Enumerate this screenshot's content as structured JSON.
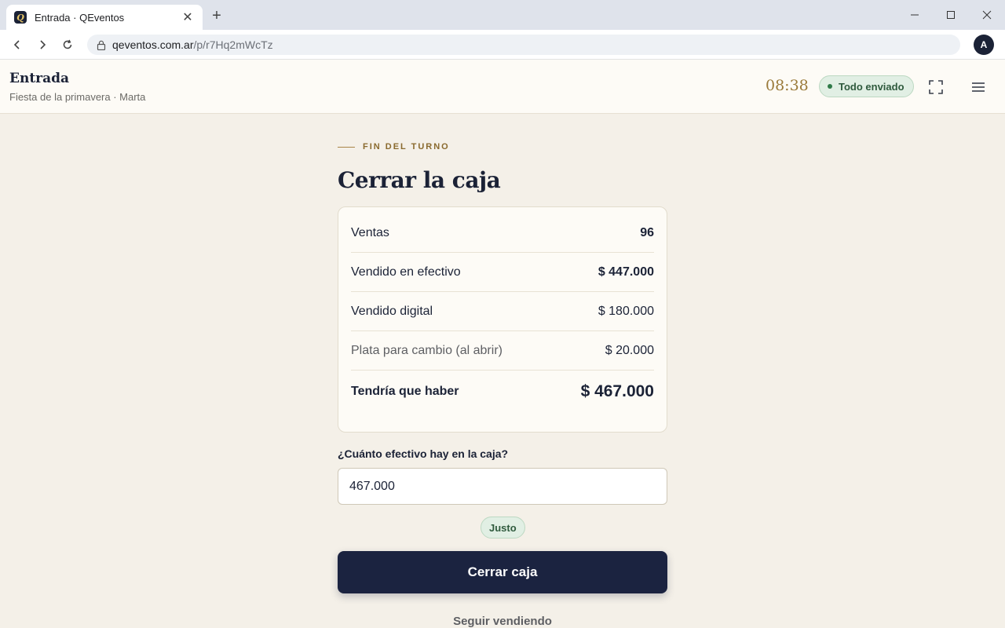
{
  "browser": {
    "tab_title": "Entrada · QEventos",
    "favicon_letter": "Q",
    "url_host": "qeventos.com.ar",
    "url_path": "/p/r7Hq2mWcTz",
    "profile_initial": "A"
  },
  "header": {
    "title": "Entrada",
    "subtitle": "Fiesta de la primavera · Marta",
    "clock": "08:38",
    "status": "Todo enviado"
  },
  "main": {
    "eyebrow": "FIN DEL TURNO",
    "title": "Cerrar la caja",
    "summary": [
      {
        "label": "Ventas",
        "value": "96"
      },
      {
        "label": "Vendido en efectivo",
        "value": "$ 447.000"
      },
      {
        "label": "Vendido digital",
        "value": "$ 180.000"
      },
      {
        "label": "Plata para cambio (al abrir)",
        "value": "$ 20.000"
      },
      {
        "label": "Tendría que haber",
        "value": "$ 467.000"
      }
    ],
    "cash_question": "¿Cuánto efectivo hay en la caja?",
    "cash_value": "467.000",
    "result": "Justo",
    "close_button": "Cerrar caja",
    "continue_link": "Seguir vendiendo"
  },
  "colors": {
    "navy": "#1b2340",
    "gold": "#9a7a3a",
    "success_bg": "#e1efe4",
    "page_bg": "#f4f0e8"
  },
  "icons": [
    "back-icon",
    "forward-icon",
    "reload-icon",
    "lock-icon",
    "fullscreen-icon",
    "menu-icon",
    "minimize-icon",
    "maximize-icon",
    "close-icon",
    "plus-icon"
  ]
}
